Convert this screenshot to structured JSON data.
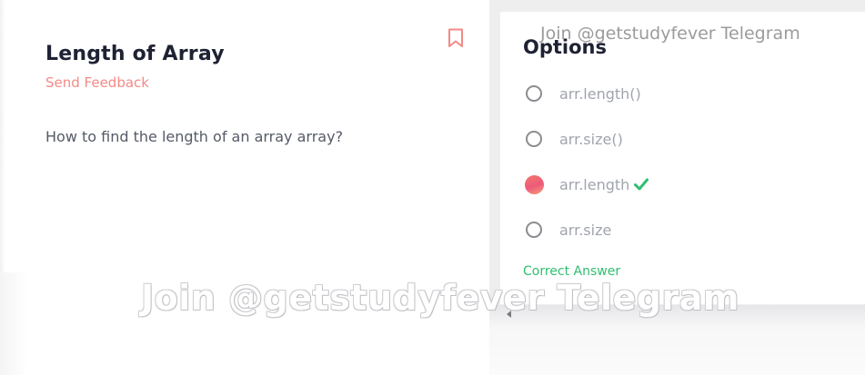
{
  "problem": {
    "title": "Length of Array",
    "feedback_label": "Send Feedback",
    "question": "How to find the length of an array array?",
    "bookmark_icon": "bookmark-icon"
  },
  "options_panel": {
    "title": "Options",
    "items": [
      {
        "label": "arr.length()",
        "selected": false
      },
      {
        "label": "arr.size()",
        "selected": false
      },
      {
        "label": "arr.length",
        "selected": true,
        "correct": true
      },
      {
        "label": "arr.size",
        "selected": false
      }
    ],
    "correct_label": "Correct Answer"
  },
  "watermarks": {
    "top": "Join @getstudyfever Telegram",
    "bottom": "Join @getstudyfever Telegram"
  },
  "colors": {
    "accent": "#f28a86",
    "correct": "#2fbf6f",
    "title": "#1e2233"
  }
}
